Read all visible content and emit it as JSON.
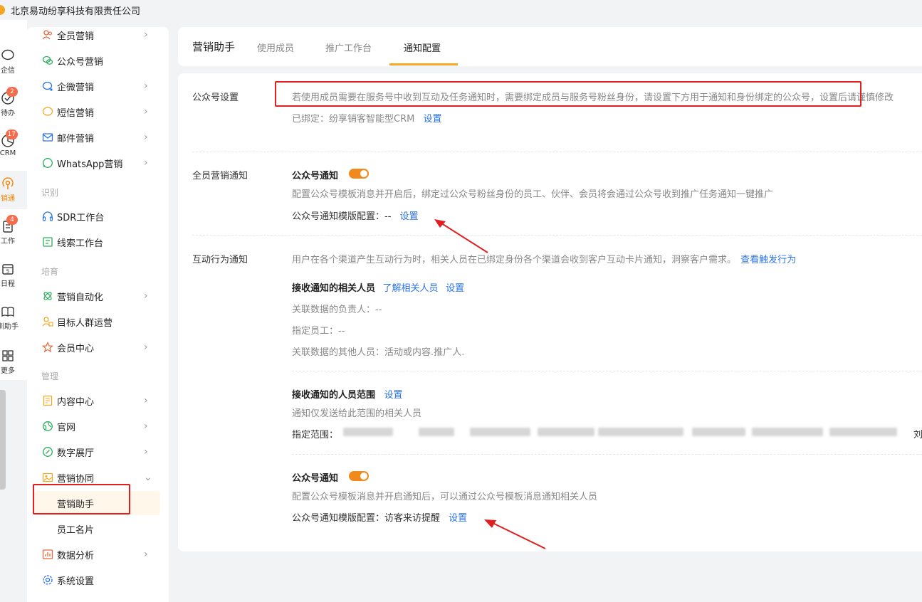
{
  "company": {
    "name": "北京易动纷享科技有限责任公司"
  },
  "rail": {
    "items": [
      {
        "label": "企信",
        "icon": "chat-bubble-icon",
        "badge": ""
      },
      {
        "label": "待办",
        "icon": "check-circle-icon",
        "badge": "2"
      },
      {
        "label": "CRM",
        "icon": "pie-chart-icon",
        "badge": "17"
      },
      {
        "label": "销通",
        "icon": "broadcast-icon",
        "badge": ""
      },
      {
        "label": "工作",
        "icon": "clipboard-icon",
        "badge": "4"
      },
      {
        "label": "日程",
        "icon": "calendar-icon",
        "badge": ""
      },
      {
        "label": "训助手",
        "icon": "book-icon",
        "badge": ""
      },
      {
        "label": "更多",
        "icon": "grid-icon",
        "badge": ""
      }
    ],
    "calendar_day": "5"
  },
  "sidebar": {
    "items": [
      {
        "label": "全员营销",
        "chev": "›"
      },
      {
        "label": "公众号营销",
        "chev": ""
      },
      {
        "label": "企微营销",
        "chev": "›"
      },
      {
        "label": "短信营销",
        "chev": "›"
      },
      {
        "label": "邮件营销",
        "chev": "›"
      },
      {
        "label": "WhatsApp营销",
        "chev": "›"
      }
    ],
    "group_identify": "识别",
    "identify_items": [
      {
        "label": "SDR工作台",
        "chev": ""
      },
      {
        "label": "线索工作台",
        "chev": ""
      }
    ],
    "group_nurture": "培育",
    "nurture_items": [
      {
        "label": "营销自动化",
        "chev": "›"
      },
      {
        "label": "目标人群运营",
        "chev": ""
      },
      {
        "label": "会员中心",
        "chev": "›"
      }
    ],
    "group_manage": "管理",
    "manage_items": [
      {
        "label": "内容中心",
        "chev": "›"
      },
      {
        "label": "官网",
        "chev": "›"
      },
      {
        "label": "数字展厅",
        "chev": "›"
      },
      {
        "label": "营销协同",
        "chev": "⌄"
      }
    ],
    "sub_items": [
      {
        "label": "营销助手"
      },
      {
        "label": "员工名片"
      }
    ],
    "bottom_items": [
      {
        "label": "数据分析",
        "chev": "›"
      },
      {
        "label": "系统设置",
        "chev": ""
      }
    ]
  },
  "tabs": {
    "title": "营销助手",
    "items": [
      "使用成员",
      "推广工作台",
      "通知配置"
    ],
    "active": "通知配置"
  },
  "official": {
    "label": "公众号设置",
    "notice": "若使用成员需要在服务号中收到互动及任务通知时，需要绑定成员与服务号粉丝身份，请设置下方用于通知和身份绑定的公众号，设置后请谨慎修改",
    "bound_prefix": "已绑定：纷享销客智能型CRM",
    "set": "设置"
  },
  "staff_notify": {
    "label": "全员营销通知",
    "title": "公众号通知",
    "desc": "配置公众号模板消息并开启后，绑定过公众号粉丝身份的员工、伙伴、会员将会通过公众号收到推广任务通知一键推广",
    "template_prefix": "公众号通知模版配置：--",
    "set": "设置"
  },
  "interact_notify": {
    "label": "互动行为通知",
    "desc": "用户在各个渠道产生互动行为时，相关人员在已绑定身份各个渠道会收到客户互动卡片通知，洞察客户需求。",
    "view_link": "查看触发行为",
    "recv_title": "接收通知的相关人员",
    "learn_link": "了解相关人员",
    "set": "设置",
    "owner": "关联数据的负责人：--",
    "staff": "指定员工：--",
    "others": "关联数据的其他人员：活动或内容.推广人.",
    "scope_title": "接收通知的人员范围",
    "scope_desc": "通知仅发送给此范围的相关人员",
    "scope_prefix": "指定范围：",
    "scope_tail": "刘",
    "wx_title": "公众号通知",
    "wx_desc": "配置公众号模板消息并开启通知后，可以通过公众号模板消息通知相关人员",
    "wx_template_prefix": "公众号通知模版配置：访客来访提醒"
  },
  "colors": {
    "accent": "#f08a1c",
    "link": "#2b73e6",
    "annotation": "#e02020"
  }
}
